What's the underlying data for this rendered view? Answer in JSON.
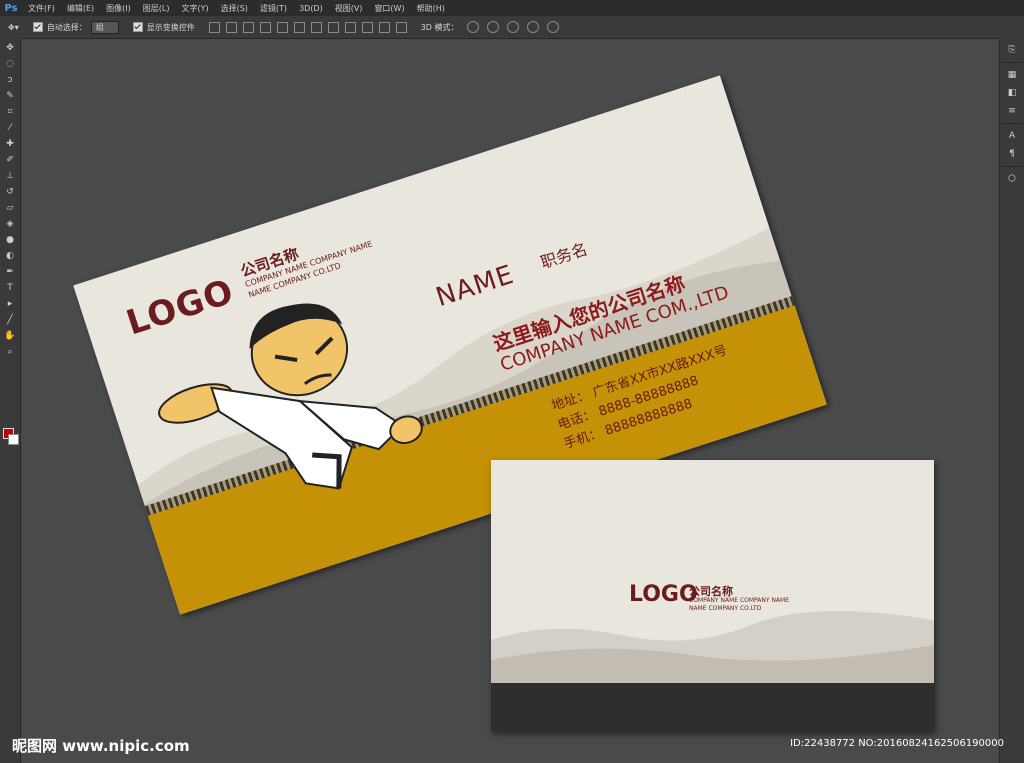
{
  "app": {
    "logo_text": "Ps"
  },
  "menu": [
    "文件(F)",
    "编辑(E)",
    "图像(I)",
    "图层(L)",
    "文字(Y)",
    "选择(S)",
    "滤镜(T)",
    "3D(D)",
    "视图(V)",
    "窗口(W)",
    "帮助(H)"
  ],
  "options": {
    "auto_select_label": "自动选择：",
    "auto_select_value": "组",
    "show_transform_label": "显示变换控件",
    "mode3d_label": "3D 模式："
  },
  "colors": {
    "foreground": "#c40000",
    "background": "#ffffff",
    "brand": "#6b1d1d",
    "band": "#c49107"
  },
  "front_card": {
    "logo": "LOGO",
    "company_short": "公司名称",
    "company_en_line1": "COMPANY NAME COMPANY NAME",
    "company_en_line2": "NAME COMPANY CO.LTD",
    "name": "NAME",
    "job_title": "职务名",
    "company_cn": "这里输入您的公司名称",
    "company_en": "COMPANY NAME COM.,LTD",
    "address": "地址：  广东省XX市XX路XXX号",
    "phone": "电话：  8888-88888888",
    "mobile": "手机：  88888888888"
  },
  "back_card": {
    "logo": "LOGO",
    "company_short": "公司名称",
    "company_en_line1": "COMPANY NAME COMPANY NAME",
    "company_en_line2": "NAME COMPANY CO.LTD"
  },
  "watermark": {
    "left": "昵图网 www.nipic.com",
    "right": "ID:22438772 NO:20160824162506190000"
  }
}
